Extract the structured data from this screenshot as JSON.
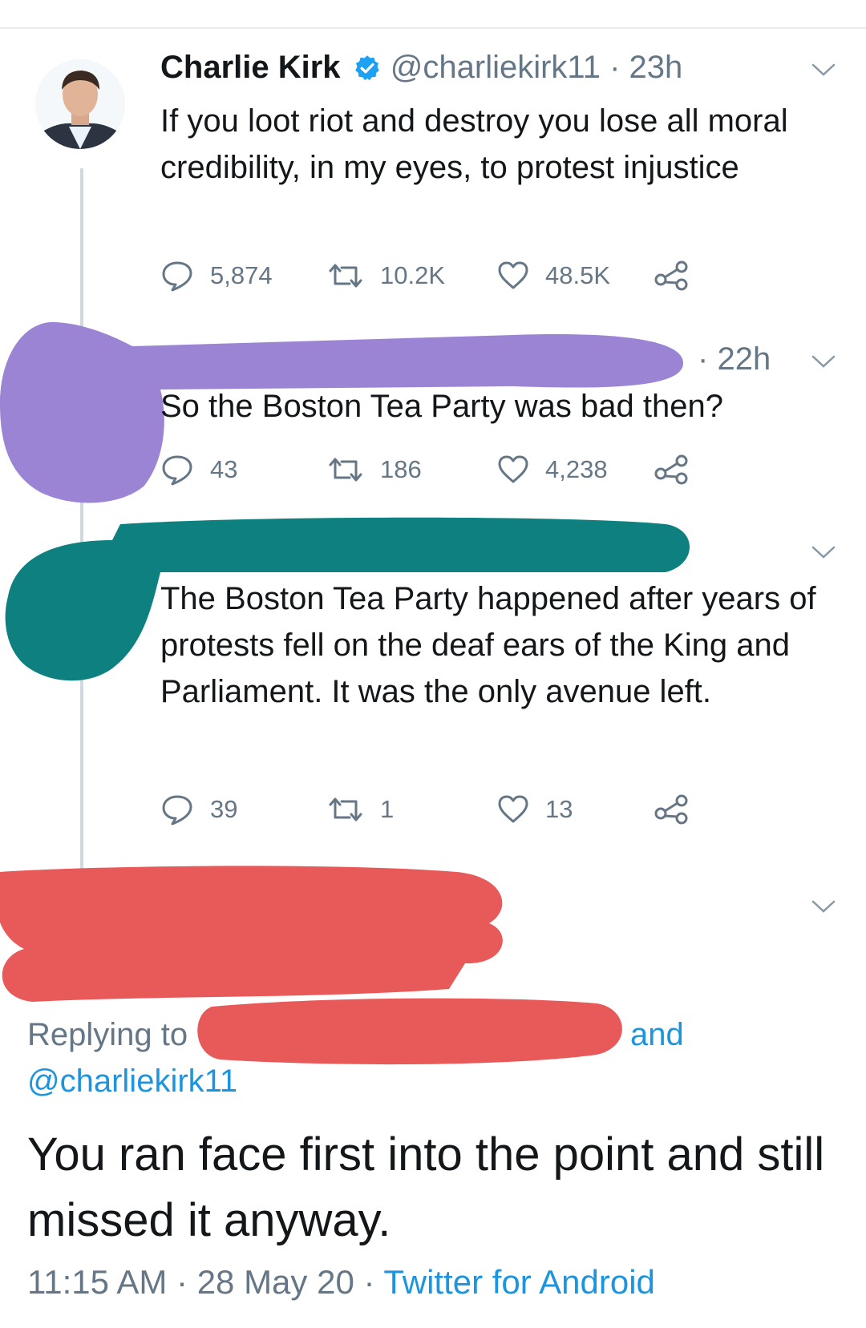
{
  "tweets": [
    {
      "author_name": "Charlie Kirk",
      "verified": true,
      "handle": "@charliekirk11",
      "separator": "·",
      "time": "23h",
      "text": "If you loot riot and destroy you lose all moral credibility, in my eyes, to protest injustice",
      "stats": {
        "replies": "5,874",
        "retweets": "10.2K",
        "likes": "48.5K"
      }
    },
    {
      "separator": "·",
      "time": "22h",
      "text": "So the Boston Tea Party was bad then?",
      "stats": {
        "replies": "43",
        "retweets": "186",
        "likes": "4,238"
      }
    },
    {
      "text": "The Boston Tea Party happened after years of protests fell on the deaf ears of the King and Parliament. It was the only avenue left.",
      "stats": {
        "replies": "39",
        "retweets": "1",
        "likes": "13"
      }
    }
  ],
  "focused_tweet": {
    "replying_to_label": "Replying to",
    "and_label": "and",
    "replying_handle": "@charliekirk11",
    "text": "You ran face first into the point and still missed it anyway.",
    "time": "11:15 AM",
    "separator": "·",
    "date": "28 May 20",
    "source": "Twitter for Android"
  },
  "colors": {
    "verified_badge": "#1da1f2",
    "link_blue": "#1b95e0",
    "muted_gray": "#657786",
    "redaction_purple": "#9b84d3",
    "redaction_teal": "#0e8080",
    "redaction_red": "#e85a5a"
  },
  "icons": [
    "reply-icon",
    "retweet-icon",
    "like-icon",
    "share-icon",
    "chevron-down-icon",
    "verified-badge-icon"
  ]
}
